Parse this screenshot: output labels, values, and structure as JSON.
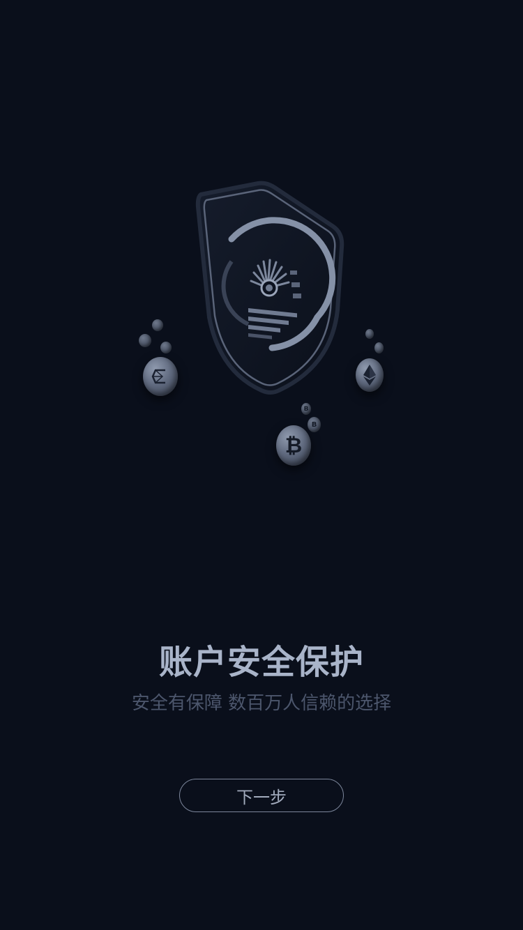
{
  "onboarding": {
    "title": "账户安全保护",
    "subtitle": "安全有保障 数百万人信赖的选择",
    "next_button_label": "下一步"
  },
  "illustration": {
    "icons": [
      "shield-icon",
      "bitcoin-coin-icon",
      "ethereum-coin-icon",
      "crypto-c-coin-icon"
    ],
    "bitcoin_glyph": "₿",
    "small_coin_glyph": "B"
  },
  "colors": {
    "background": "#0a0f1b",
    "title": "#a9b4c9",
    "subtitle": "#4c566c",
    "button_border": "#7d879c",
    "button_text": "#a2abbd"
  }
}
